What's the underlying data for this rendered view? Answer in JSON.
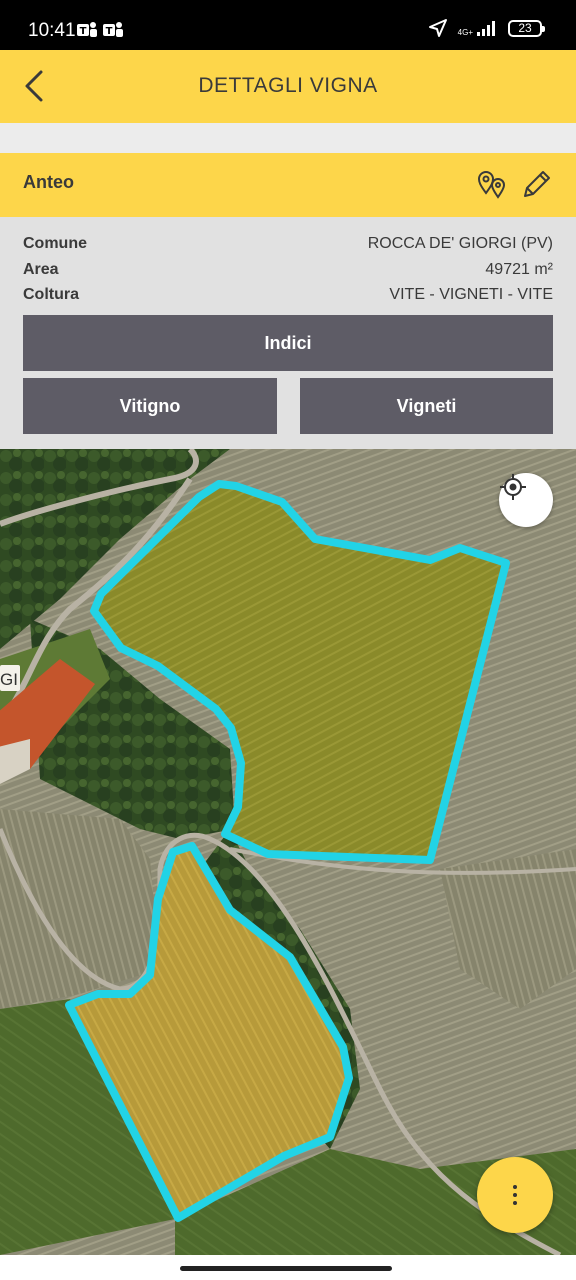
{
  "status_bar": {
    "time": "10:41",
    "network": "4G+",
    "battery": "23",
    "icons": [
      "teams-icon",
      "teams-icon",
      "location-arrow-icon",
      "signal-icon",
      "battery-icon"
    ]
  },
  "app_bar": {
    "title": "DETTAGLI VIGNA",
    "back_icon": "chevron-left-icon"
  },
  "vineyard": {
    "name": "Anteo",
    "action_icons": [
      "map-pins-icon",
      "pencil-icon"
    ]
  },
  "details": [
    {
      "label": "Comune",
      "value": "ROCCA DE' GIORGI (PV)"
    },
    {
      "label": "Area",
      "value": "49721 m²"
    },
    {
      "label": "Coltura",
      "value": "VITE - VIGNETI - VITE"
    }
  ],
  "buttons": {
    "indici": "Indici",
    "vitigno": "Vitigno",
    "vigneti": "Vigneti"
  },
  "map": {
    "place_label": "GI",
    "outline_color": "#22d3e6",
    "locate_icon": "crosshair-icon",
    "fab_icon": "more-vertical-icon"
  },
  "colors": {
    "accent": "#fdd64a",
    "button_dark": "#5e5c66",
    "panel": "#e1e1e1"
  }
}
